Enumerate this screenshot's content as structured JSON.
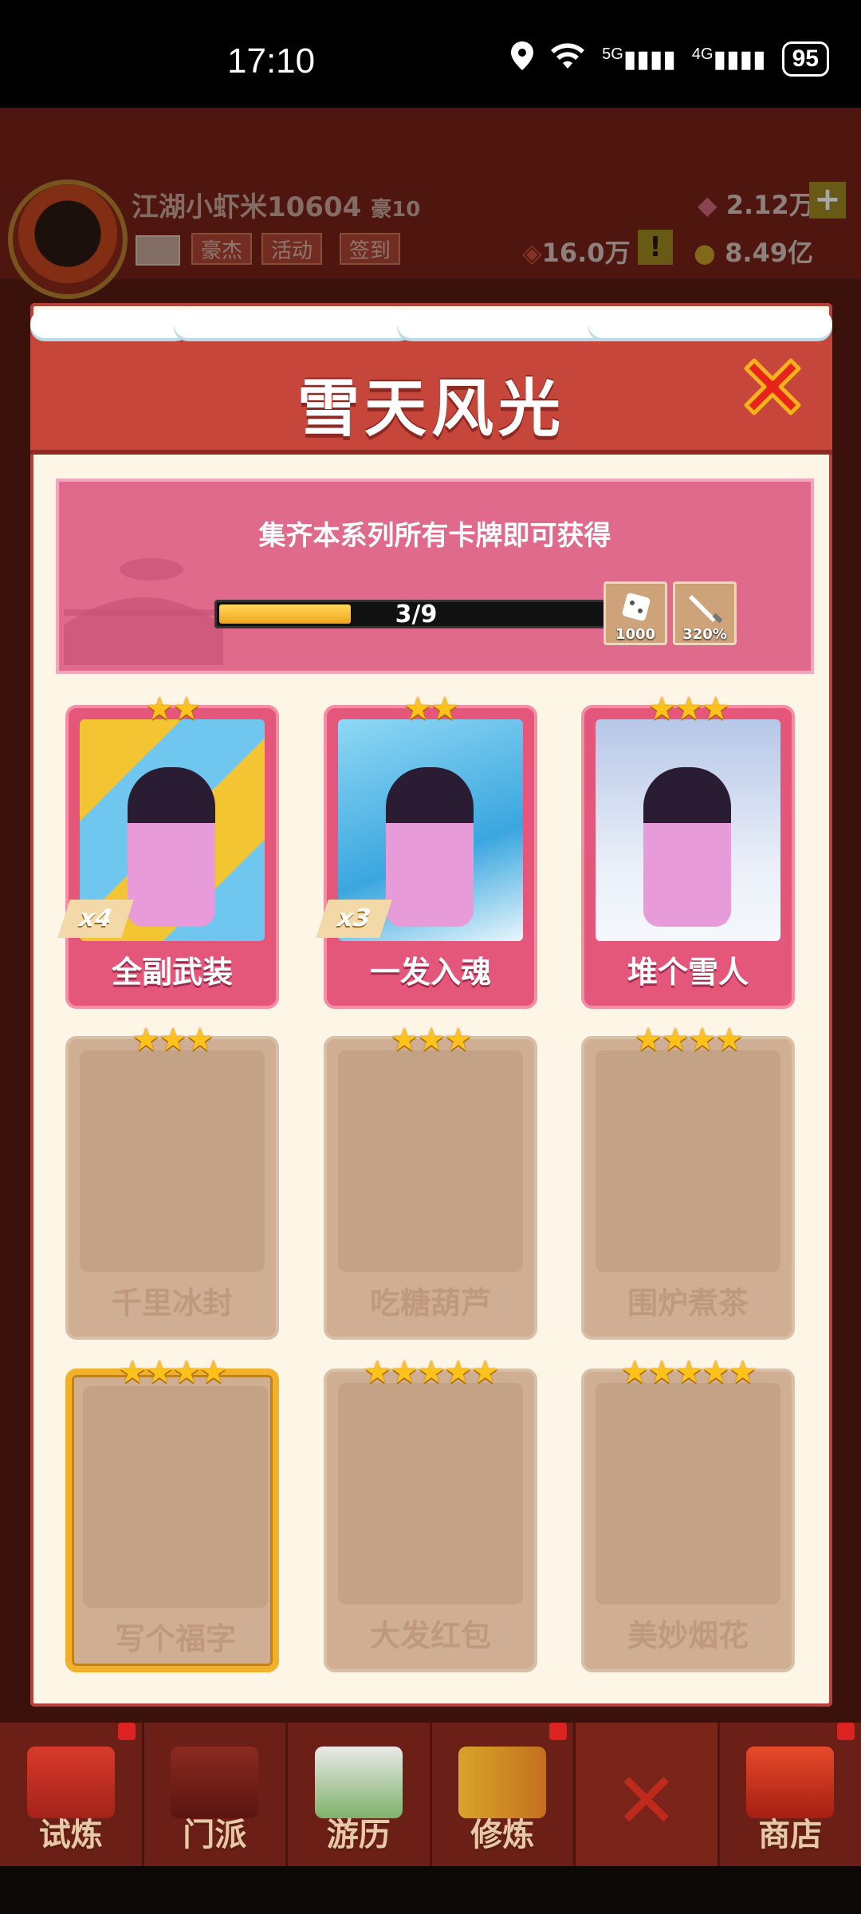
{
  "status_bar": {
    "time": "17:10",
    "network_5g": "5G",
    "network_4g": "4G",
    "battery": "95"
  },
  "header": {
    "player_name": "江湖小虾米10604",
    "vip_badge": "豪10",
    "buttons": [
      "豪杰",
      "活动",
      "签到"
    ],
    "gems": "2.12万",
    "power": "16.0万",
    "coins": "8.49亿"
  },
  "modal": {
    "title": "雪天风光",
    "banner_text": "集齐本系列所有卡牌即可获得",
    "progress": {
      "current": 3,
      "total": 9,
      "label": "3/9"
    },
    "rewards": [
      {
        "icon": "dice-icon",
        "value": "1000"
      },
      {
        "icon": "sword-icon",
        "value": "320%"
      }
    ],
    "cards": [
      {
        "name": "全副武装",
        "stars": "★★",
        "owned": true,
        "count": "x4"
      },
      {
        "name": "一发入魂",
        "stars": "★★",
        "owned": true,
        "count": "x3"
      },
      {
        "name": "堆个雪人",
        "stars": "★★★",
        "owned": true,
        "count": ""
      },
      {
        "name": "千里冰封",
        "stars": "★★★",
        "owned": false,
        "count": ""
      },
      {
        "name": "吃糖葫芦",
        "stars": "★★★",
        "owned": false,
        "count": ""
      },
      {
        "name": "围炉煮茶",
        "stars": "★★★★",
        "owned": false,
        "count": ""
      },
      {
        "name": "写个福字",
        "stars": "★★★★",
        "owned": false,
        "count": ""
      },
      {
        "name": "大发红包",
        "stars": "★★★★★",
        "owned": false,
        "count": ""
      },
      {
        "name": "美妙烟花",
        "stars": "★★★★★",
        "owned": false,
        "count": ""
      }
    ]
  },
  "bottom_nav": {
    "items": [
      "试炼",
      "门派",
      "游历",
      "修炼",
      "",
      "商店"
    ]
  },
  "colors": {
    "title_bar": "#c7463c",
    "card_owned": "#e5577a",
    "card_locked": "#cfae94",
    "star": "#ffc21a",
    "progress": "#f0a51a"
  }
}
